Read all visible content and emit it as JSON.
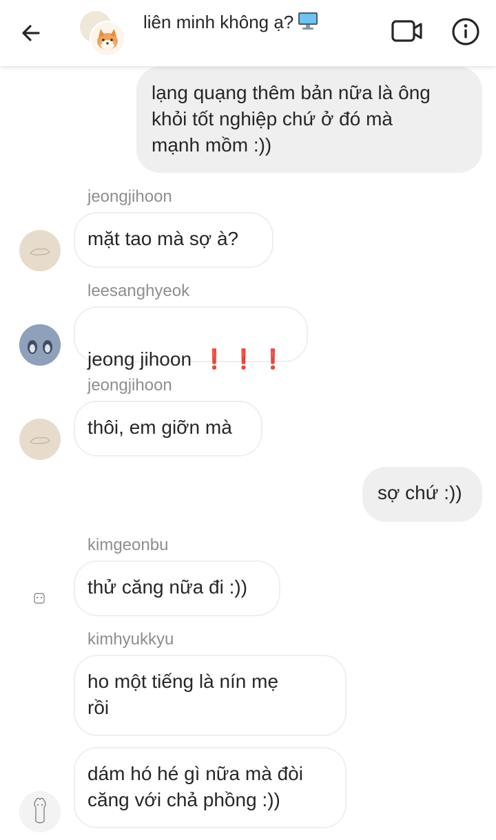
{
  "header": {
    "title": "liên minh không ạ?",
    "title_icon": "desktop-computer-emoji",
    "back_icon": "back-arrow-icon",
    "video_icon": "video-call-icon",
    "info_icon": "info-icon"
  },
  "messages": [
    {
      "direction": "outgoing",
      "text": "lạng quạng thêm bản nữa là ông\nkhỏi tốt nghiệp chứ ở đó mà\nmạnh mồm :))"
    },
    {
      "direction": "incoming",
      "sender": "jeongjihoon",
      "text": "mặt tao mà sợ à?"
    },
    {
      "direction": "incoming",
      "sender": "leesanghyeok",
      "text": "jeong jihoon",
      "emoji": "❗ ❗ ❗"
    },
    {
      "direction": "incoming",
      "sender": "jeongjihoon",
      "text": "thôi, em giỡn mà"
    },
    {
      "direction": "outgoing",
      "text": "sợ chứ :))"
    },
    {
      "direction": "incoming",
      "sender": "kimgeonbu",
      "text": "thử căng nữa đi :))"
    },
    {
      "direction": "incoming",
      "sender": "kimhyukkyu",
      "text": "ho một tiếng là nín mẹ\nrồi"
    },
    {
      "direction": "incoming",
      "text": "dám hó hé gì nữa mà đòi\ncăng với chả phồng :))"
    }
  ],
  "colors": {
    "outgoing_bubble": "#efefef",
    "incoming_border": "#efefef",
    "sender_text": "#8e8e8e",
    "emoji_red": "#e02d2d"
  }
}
